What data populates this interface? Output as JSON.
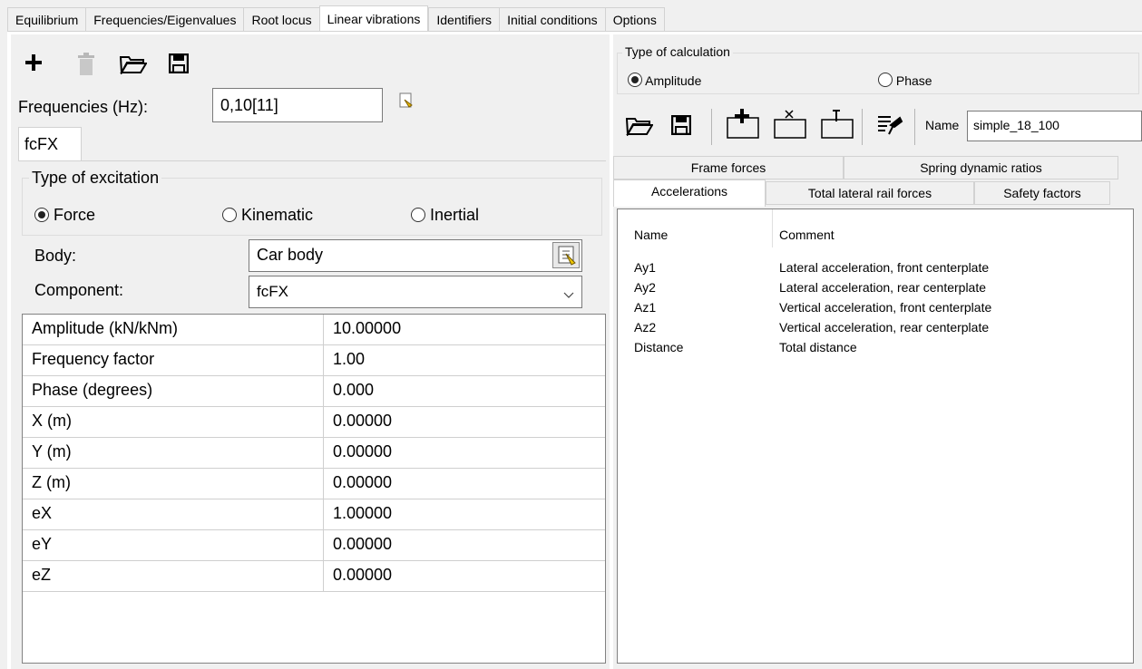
{
  "tabs": [
    {
      "label": "Equilibrium"
    },
    {
      "label": "Frequencies/Eigenvalues"
    },
    {
      "label": "Root locus"
    },
    {
      "label": "Linear vibrations"
    },
    {
      "label": "Identifiers"
    },
    {
      "label": "Initial conditions"
    },
    {
      "label": "Options"
    }
  ],
  "left": {
    "frequencies_label": "Frequencies (Hz):",
    "frequencies_value": "0,10[11]",
    "subtab": "fcFX",
    "excitation": {
      "legend": "Type of excitation",
      "options": [
        "Force",
        "Kinematic",
        "Inertial"
      ],
      "selected": "Force"
    },
    "body_label": "Body:",
    "body_value": "Car body",
    "component_label": "Component:",
    "component_value": "fcFX",
    "params": [
      {
        "name": "Amplitude (kN/kNm)",
        "value": "10.00000"
      },
      {
        "name": "Frequency factor",
        "value": "1.00"
      },
      {
        "name": "Phase (degrees)",
        "value": "0.000"
      },
      {
        "name": "X (m)",
        "value": "0.00000"
      },
      {
        "name": "Y (m)",
        "value": "0.00000"
      },
      {
        "name": "Z (m)",
        "value": "0.00000"
      },
      {
        "name": "eX",
        "value": "1.00000"
      },
      {
        "name": "eY",
        "value": "0.00000"
      },
      {
        "name": "eZ",
        "value": "0.00000"
      }
    ]
  },
  "right": {
    "calc_legend": "Type of calculation",
    "calc_options": [
      "Amplitude",
      "Phase"
    ],
    "calc_selected": "Amplitude",
    "name_label": "Name",
    "name_value": "simple_18_100",
    "tabs_row1": [
      "Frame forces",
      "Spring dynamic ratios"
    ],
    "tabs_row2": [
      "Accelerations",
      "Total lateral rail forces",
      "Safety factors"
    ],
    "active_tab": "Accelerations",
    "list_headers": [
      "Name",
      "Comment"
    ],
    "list_rows": [
      {
        "name": "Ay1",
        "comment": "Lateral acceleration, front centerplate"
      },
      {
        "name": "Ay2",
        "comment": "Lateral acceleration, rear centerplate"
      },
      {
        "name": "Az1",
        "comment": "Vertical acceleration, front centerplate"
      },
      {
        "name": "Az2",
        "comment": "Vertical acceleration, rear centerplate"
      },
      {
        "name": "Distance",
        "comment": "Total distance"
      }
    ]
  }
}
